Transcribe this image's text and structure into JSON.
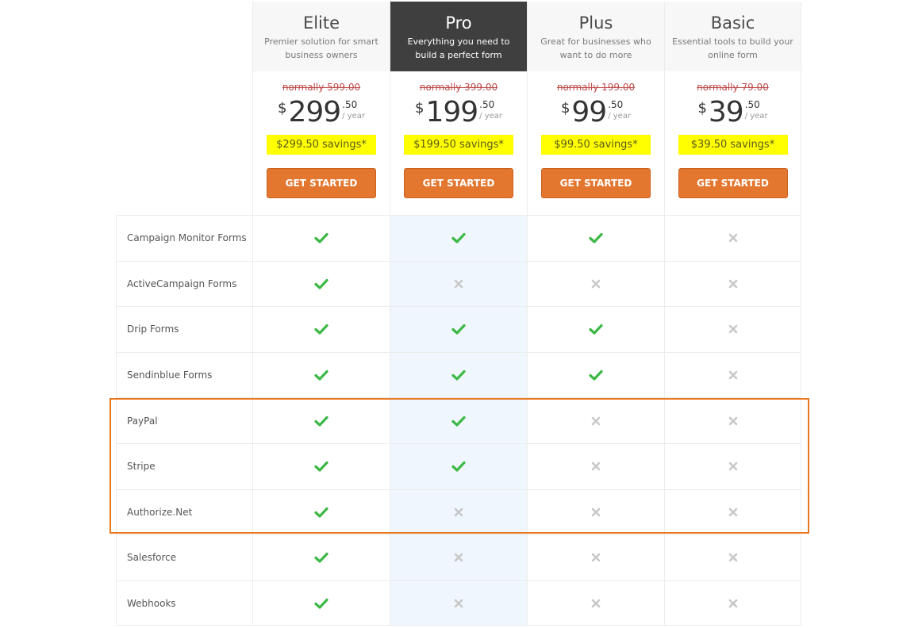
{
  "plans": [
    {
      "name": "Elite",
      "description": "Premier solution for smart business owners",
      "normally": "normally 599.00",
      "currency": "$",
      "price_whole": "299",
      "price_cents": ".50",
      "period": "/ year",
      "savings": "$299.50 savings*",
      "cta_label": "GET STARTED",
      "featured": false
    },
    {
      "name": "Pro",
      "description": "Everything you need to build a perfect form",
      "normally": "normally 399.00",
      "currency": "$",
      "price_whole": "199",
      "price_cents": ".50",
      "period": "/ year",
      "savings": "$199.50 savings*",
      "cta_label": "GET STARTED",
      "featured": true
    },
    {
      "name": "Plus",
      "description": "Great for businesses who want to do more",
      "normally": "normally 199.00",
      "currency": "$",
      "price_whole": "99",
      "price_cents": ".50",
      "period": "/ year",
      "savings": "$99.50 savings*",
      "cta_label": "GET STARTED",
      "featured": false
    },
    {
      "name": "Basic",
      "description": "Essential tools to build your online form",
      "normally": "normally 79.00",
      "currency": "$",
      "price_whole": "39",
      "price_cents": ".50",
      "period": "/ year",
      "savings": "$39.50 savings*",
      "cta_label": "GET STARTED",
      "featured": false
    }
  ],
  "features": [
    {
      "label": "Campaign Monitor Forms",
      "included": [
        true,
        true,
        true,
        false
      ]
    },
    {
      "label": "ActiveCampaign Forms",
      "included": [
        true,
        false,
        false,
        false
      ]
    },
    {
      "label": "Drip Forms",
      "included": [
        true,
        true,
        true,
        false
      ]
    },
    {
      "label": "Sendinblue Forms",
      "included": [
        true,
        true,
        true,
        false
      ]
    },
    {
      "label": "PayPal",
      "included": [
        true,
        true,
        false,
        false
      ]
    },
    {
      "label": "Stripe",
      "included": [
        true,
        true,
        false,
        false
      ]
    },
    {
      "label": "Authorize.Net",
      "included": [
        true,
        false,
        false,
        false
      ]
    },
    {
      "label": "Salesforce",
      "included": [
        true,
        false,
        false,
        false
      ]
    },
    {
      "label": "Webhooks",
      "included": [
        true,
        false,
        false,
        false
      ]
    }
  ],
  "highlighted_features": [
    "PayPal",
    "Stripe",
    "Authorize.Net"
  ],
  "colors": {
    "check": "#3cb846",
    "cross": "#c8c8c8",
    "cta": "#e47730",
    "savings_highlight": "#ffff00",
    "featured_header": "#3f3f3f",
    "featured_column": "#eff6fd",
    "highlight_box": "#e87722"
  }
}
